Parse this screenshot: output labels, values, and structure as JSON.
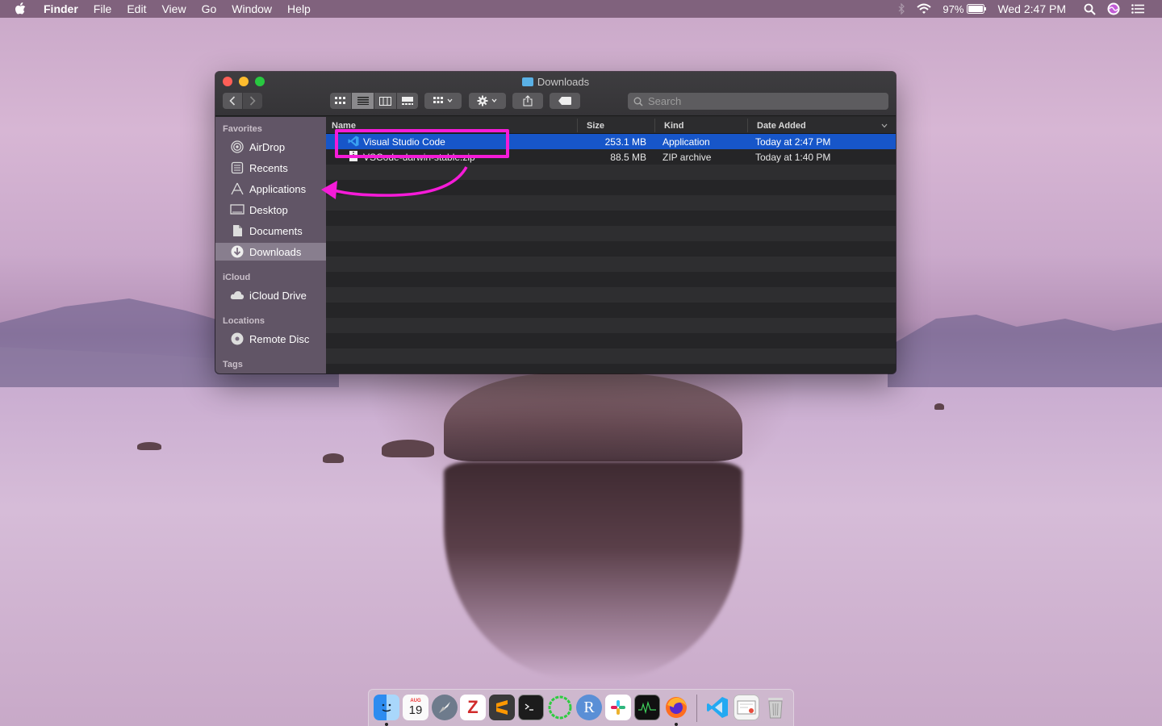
{
  "menubar": {
    "app_name": "Finder",
    "menus": [
      "File",
      "Edit",
      "View",
      "Go",
      "Window",
      "Help"
    ],
    "battery": "97%",
    "clock": "Wed 2:47 PM",
    "icons": [
      "apple-icon",
      "bluetooth-icon",
      "wifi-icon",
      "battery-icon",
      "spotlight-icon",
      "siri-icon",
      "notification-center-icon"
    ]
  },
  "window": {
    "title": "Downloads",
    "search_placeholder": "Search",
    "toolbar_icons": [
      "back-icon",
      "forward-icon",
      "icon-view-icon",
      "list-view-icon",
      "column-view-icon",
      "gallery-view-icon",
      "group-icon",
      "action-gear-icon",
      "share-icon",
      "tag-icon"
    ]
  },
  "sidebar": {
    "sections": {
      "favorites": "Favorites",
      "icloud": "iCloud",
      "locations": "Locations",
      "tags": "Tags"
    },
    "favorites": [
      "AirDrop",
      "Recents",
      "Applications",
      "Desktop",
      "Documents",
      "Downloads"
    ],
    "icloud_items": [
      "iCloud Drive"
    ],
    "location_items": [
      "Remote Disc"
    ],
    "selected": "Downloads"
  },
  "table": {
    "columns": [
      "Name",
      "Size",
      "Kind",
      "Date Added"
    ],
    "rows": [
      {
        "name": "Visual Studio Code",
        "size": "253.1 MB",
        "kind": "Application",
        "date": "Today at 2:47 PM"
      },
      {
        "name": "VSCode-darwin-stable.zip",
        "size": "88.5 MB",
        "kind": "ZIP archive",
        "date": "Today at 1:40 PM"
      }
    ],
    "selected_row": 0
  },
  "annotation": {
    "color": "#f51bd8"
  },
  "dock": {
    "apps": [
      "finder-icon",
      "calendar-icon",
      "launchpad-icon",
      "zotero-icon",
      "sublime-text-icon",
      "terminal-icon",
      "activity-ring-icon",
      "r-icon",
      "slack-icon",
      "activity-monitor-icon",
      "firefox-icon",
      "vscode-icon",
      "preview-icon",
      "trash-icon"
    ],
    "calendar_month": "AUG",
    "calendar_day": "19",
    "r_label": "R",
    "zotero_label": "Z"
  }
}
